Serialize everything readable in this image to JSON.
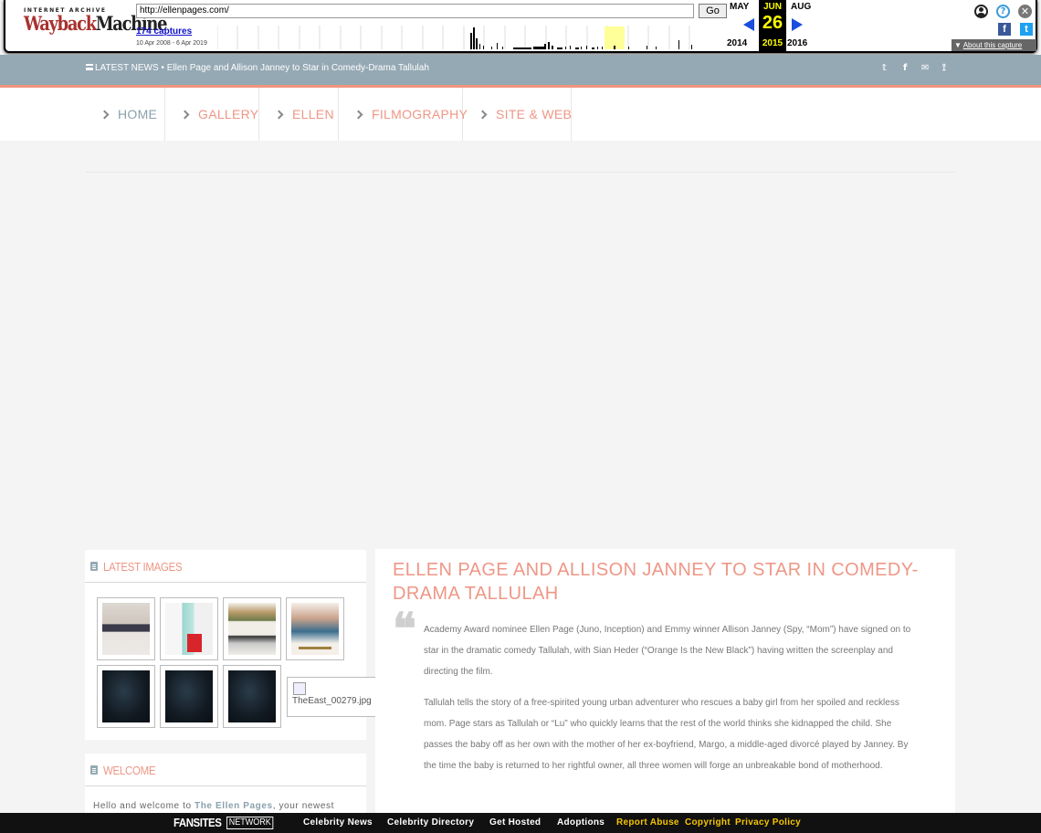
{
  "wayback": {
    "logo_top": "INTERNET ARCHIVE",
    "logo_main_a": "Wayback",
    "logo_main_b": "Machine",
    "url": "http://ellenpages.com/",
    "go_label": "Go",
    "captures": "174 captures",
    "range": "10 Apr 2008 - 6 Apr 2019",
    "prev_month": "MAY",
    "cur_month": "JUN",
    "next_month": "AUG",
    "cur_day": "26",
    "prev_year": "2014",
    "cur_year": "2015",
    "next_year": "2016",
    "about": "About this capture",
    "icons": [
      "user-icon",
      "help-icon",
      "close-icon",
      "facebook-icon",
      "twitter-icon",
      "prev-arrow-icon",
      "next-arrow-icon"
    ]
  },
  "newsbar": {
    "text": "LATEST NEWS • Ellen Page and Allison Janney to Star in Comedy-Drama Tallulah",
    "social": [
      "twitter-icon",
      "facebook-icon",
      "mail-icon",
      "rss-icon"
    ]
  },
  "nav": {
    "items": [
      "HOME",
      "GALLERY",
      "ELLEN",
      "FILMOGRAPHY",
      "SITE & WEB"
    ]
  },
  "latest_images": {
    "title": "LATEST IMAGES",
    "broken_alt": "TheEast_00279.jpg"
  },
  "welcome": {
    "title": "WELCOME",
    "text_a": "Hello and welcome to",
    "link": "The Ellen Pages",
    "text_b": ", your newest"
  },
  "article": {
    "title": "ELLEN PAGE AND ALLISON JANNEY TO STAR IN COMEDY-DRAMA TALLULAH",
    "p1": "Academy Award nominee Ellen Page (Juno, Inception) and Emmy winner Allison Janney (Spy, “Mom”) have signed on to star in the dramatic comedy Tallulah, with Sian Heder (“Orange Is the New Black”) having written the screenplay and directing the film.",
    "p2": "Tallulah tells the story of a free-spirited young urban adventurer who rescues a baby girl from her spoiled and reckless mom. Page stars as Tallulah or “Lu” who quickly learns that the rest of the world thinks she kidnapped the child. She passes the baby off as her own with the mother of her ex-boyfriend, Margo, a middle-aged divorcé played by Janney. By the time the baby is returned to her rightful owner, all three women will forge an unbreakable bond of motherhood."
  },
  "footer": {
    "logo": "FANSITES",
    "network": "NETWORK",
    "links": [
      "Celebrity News",
      "Celebrity Directory",
      "Get Hosted",
      "Adoptions"
    ],
    "links_yellow": [
      "Report Abuse",
      "Copyright",
      "Privacy Policy"
    ]
  },
  "colors": {
    "accent": "#ee9786",
    "slate": "#95a9b4",
    "wayback_yellow": "#ffff00"
  }
}
